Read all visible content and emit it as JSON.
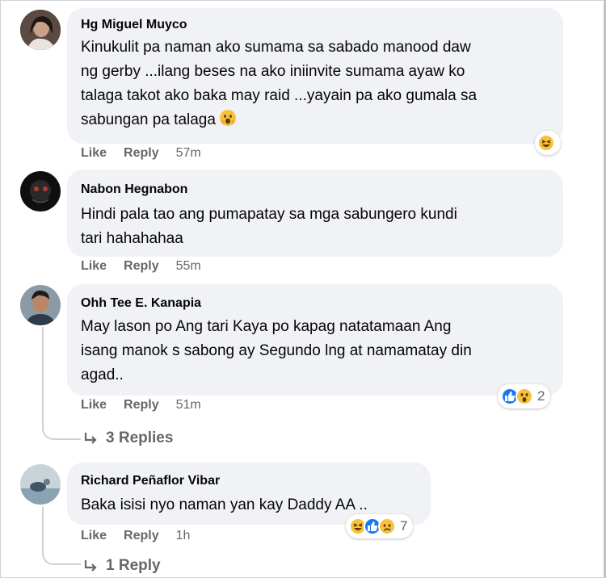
{
  "comments": [
    {
      "author": "Hg Miguel Muyco",
      "lines": [
        "Kinukulit pa naman ako sumama sa sabado manood daw",
        "ng gerby ...ilang beses na ako iniinvite sumama ayaw ko",
        "talaga takot ako baka may raid ...yayain pa ako gumala sa",
        "sabungan pa talaga"
      ],
      "like": "Like",
      "reply": "Reply",
      "time": "57m",
      "reactions": [
        "haha-icon"
      ],
      "reaction_count": ""
    },
    {
      "author": "Nabon Hegnabon",
      "lines": [
        "Hindi pala tao ang pumapatay sa mga sabungero kundi",
        "tari hahahahaa"
      ],
      "like": "Like",
      "reply": "Reply",
      "time": "55m"
    },
    {
      "author": "Ohh Tee E. Kanapia",
      "lines": [
        "May lason po Ang tari Kaya po kapag natatamaan Ang",
        "isang manok s sabong ay Segundo lng at namamatay din",
        "agad.."
      ],
      "like": "Like",
      "reply": "Reply",
      "time": "51m",
      "reactions": [
        "like-icon",
        "wow-icon"
      ],
      "reaction_count": "2",
      "replies_label": "3 Replies"
    },
    {
      "author": "Richard Peñaflor Vibar",
      "lines": [
        "Baka isisi nyo naman yan kay Daddy AA .."
      ],
      "like": "Like",
      "reply": "Reply",
      "time": "1h",
      "reactions": [
        "haha-icon",
        "like-icon",
        "sad-icon"
      ],
      "reaction_count": "7",
      "replies_label": "1 Reply"
    }
  ],
  "colors": {
    "bubble": "#f0f2f5",
    "meta": "#65676b",
    "like_blue": "#1877f2",
    "emoji_yellow": "#f7c23b"
  }
}
